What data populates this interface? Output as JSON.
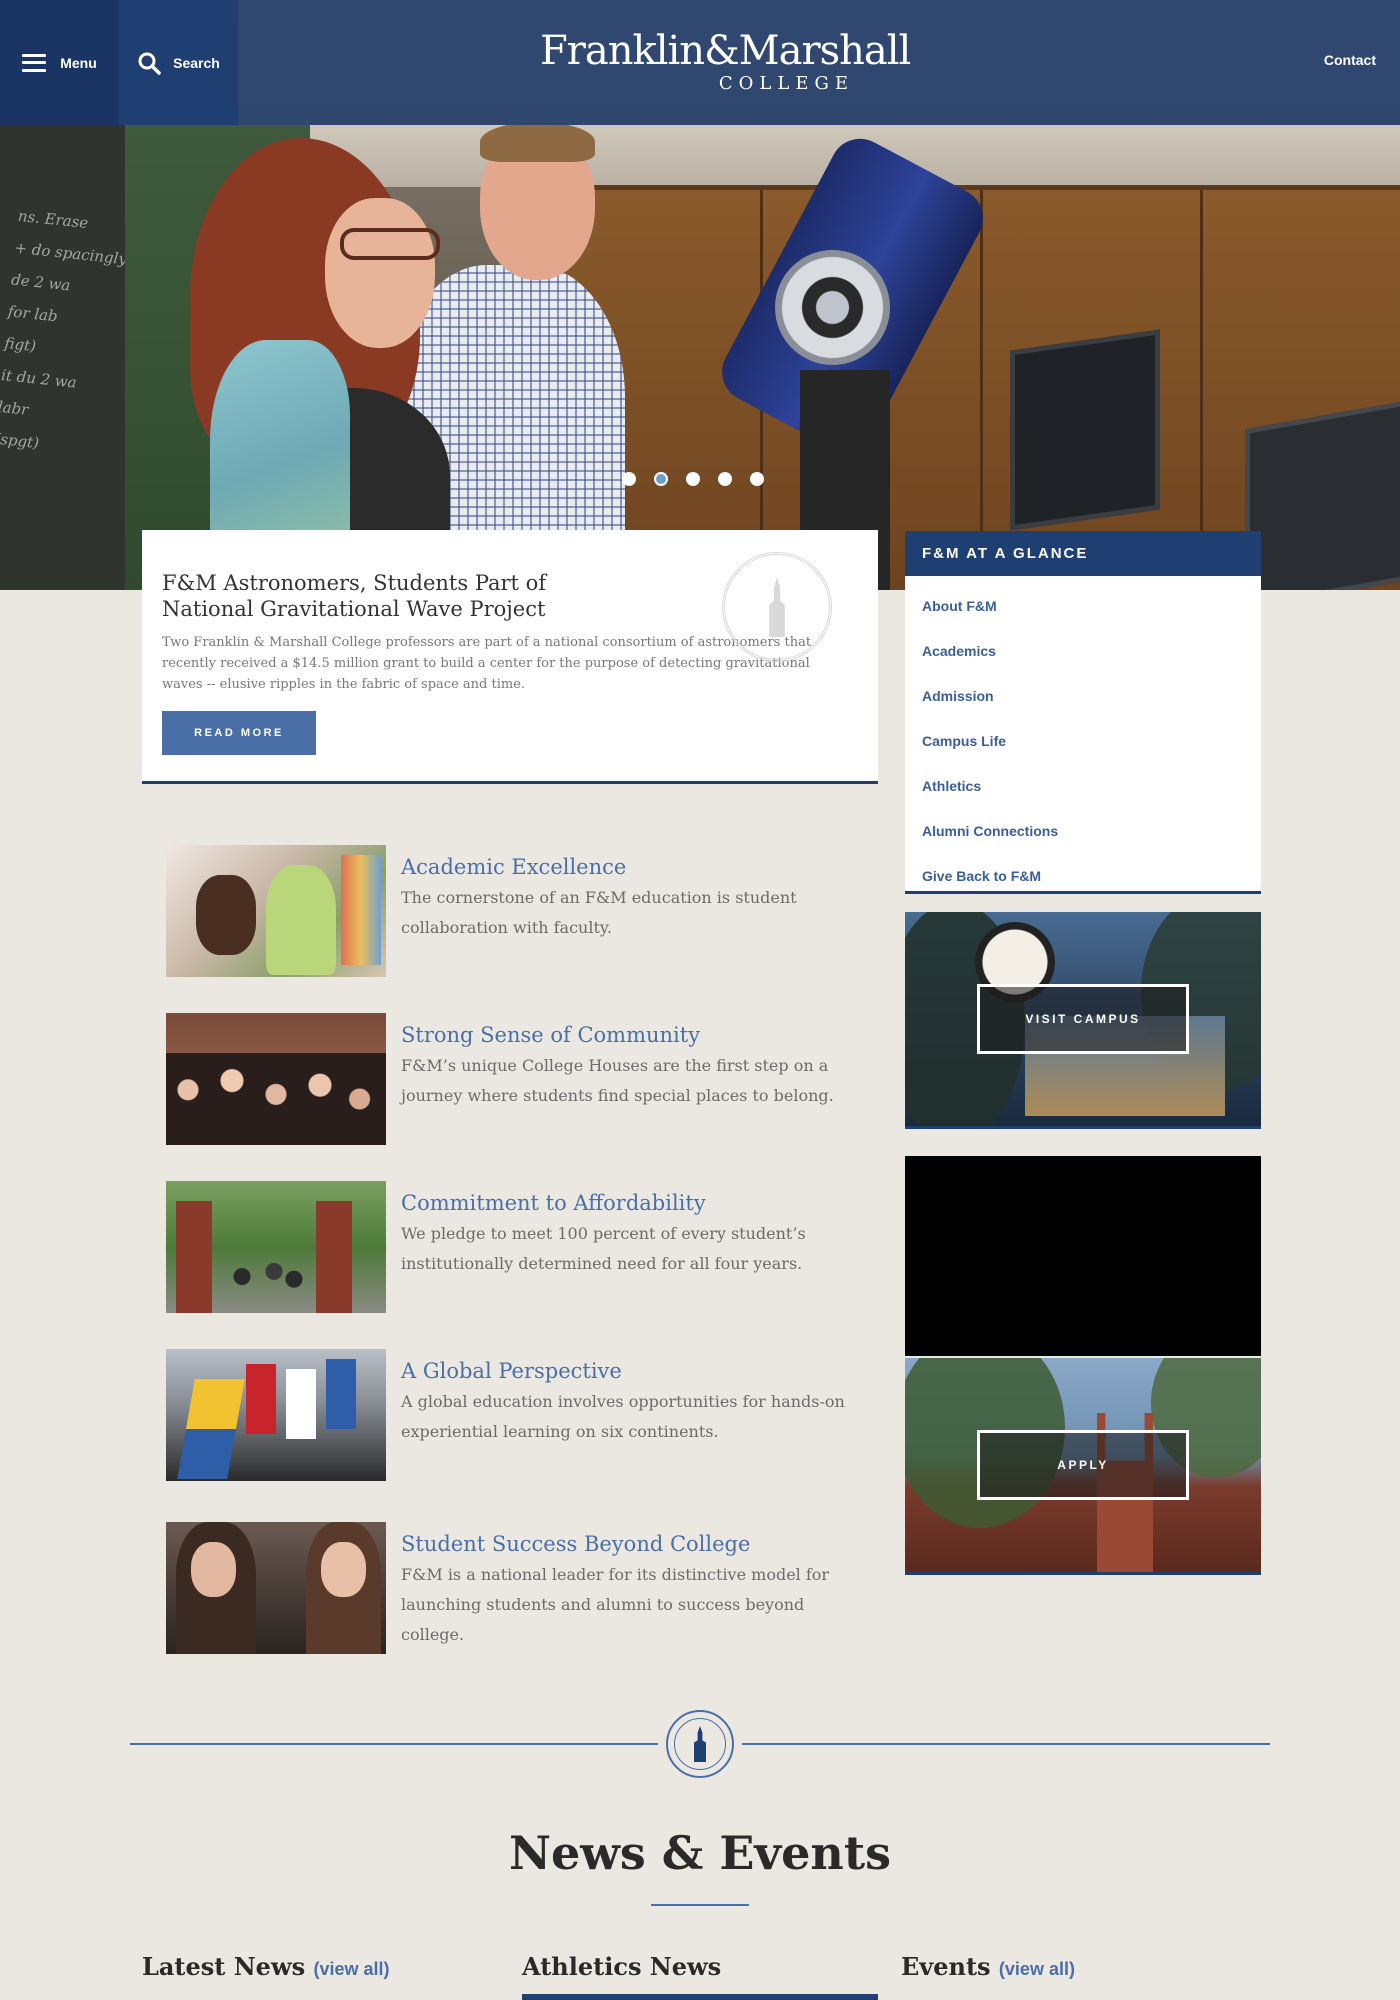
{
  "header": {
    "menu_label": "Menu",
    "search_label": "Search",
    "logo_main": "Franklin&Marshall",
    "logo_sub": "COLLEGE",
    "contact_label": "Contact"
  },
  "hero": {
    "slides_count": 5,
    "active_slide": 2,
    "chalk_text": "ns. Erase\n+ do spacingly\nde 2 wa\nfor lab\nfigt)\nit du 2 wa\nlabr\n(spgt)"
  },
  "feature": {
    "title": "F&M Astronomers, Students Part of National Gravitational Wave Project",
    "text": " Two Franklin & Marshall College professors are part of a national consortium of astronomers that recently received a $14.5 million grant to build a center for the purpose of detecting gravitational waves -- elusive ripples in the fabric of space and time.",
    "button_label": "READ MORE"
  },
  "glance": {
    "heading": "F&M AT A GLANCE",
    "items": [
      "About F&M",
      "Academics",
      "Admission",
      "Campus Life",
      "Athletics",
      "Alumni Connections",
      "Give Back to F&M"
    ]
  },
  "promos": {
    "visit_label": "VISIT CAMPUS",
    "apply_label": "APPLY"
  },
  "highlights": [
    {
      "title": "Academic Excellence",
      "text": "The cornerstone of an F&M education is student collaboration with faculty."
    },
    {
      "title": "Strong Sense of Community",
      "text": "F&M’s unique College Houses are the first step on a journey where students find special places to belong."
    },
    {
      "title": "Commitment to Affordability",
      "text": "We pledge to meet 100 percent of every student’s institutionally determined need for all four years."
    },
    {
      "title": "A Global Perspective",
      "text": "A global education involves opportunities for hands-on experiential learning on six continents."
    },
    {
      "title": "Student Success Beyond College",
      "text": "F&M is a national leader for its distinctive model for launching students and alumni to success beyond college."
    }
  ],
  "news": {
    "heading": "News & Events",
    "columns": [
      {
        "title": "Latest News",
        "link": "(view all)"
      },
      {
        "title": "Athletics News",
        "link": ""
      },
      {
        "title": "Events",
        "link": "(view all)"
      }
    ]
  },
  "colors": {
    "navy": "#1f3e72",
    "accent_blue": "#4a6ea6",
    "page_bg": "#ebe8e2"
  }
}
